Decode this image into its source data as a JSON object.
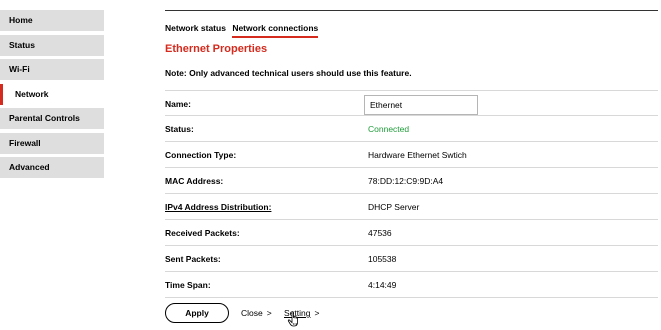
{
  "sidebar": {
    "items": [
      {
        "label": "Home"
      },
      {
        "label": "Status"
      },
      {
        "label": "Wi-Fi"
      },
      {
        "label": "Network"
      },
      {
        "label": "Parental Controls"
      },
      {
        "label": "Firewall"
      },
      {
        "label": "Advanced"
      }
    ],
    "active": "Network"
  },
  "tabs": [
    {
      "label": "Network status"
    },
    {
      "label": "Network connections"
    }
  ],
  "active_tab": "Network connections",
  "section_title": "Ethernet Properties",
  "note": "Note: Only advanced technical users should use this feature.",
  "properties": {
    "name": {
      "label": "Name:",
      "value": "Ethernet"
    },
    "status": {
      "label": "Status:",
      "value": "Connected"
    },
    "connection_type": {
      "label": "Connection Type:",
      "value": "Hardware Ethernet Swtich"
    },
    "mac_address": {
      "label": "MAC Address:",
      "value": "78:DD:12:C9:9D:A4"
    },
    "ipv4": {
      "label": "IPv4 Address Distribution:",
      "value": "DHCP Server"
    },
    "received_packets": {
      "label": "Received Packets:",
      "value": "47536"
    },
    "sent_packets": {
      "label": "Sent Packets:",
      "value": "105538"
    },
    "time_span": {
      "label": "Time Span:",
      "value": "4:14:49"
    }
  },
  "actions": {
    "apply": "Apply",
    "close": "Close",
    "setting": "Setting",
    "chevron": ">"
  },
  "colors": {
    "accent": "#d52b1e",
    "status_ok": "#1f9d3a",
    "nav_bg": "#dedede"
  },
  "icons": {
    "cursor": "hand-pointer-icon"
  }
}
